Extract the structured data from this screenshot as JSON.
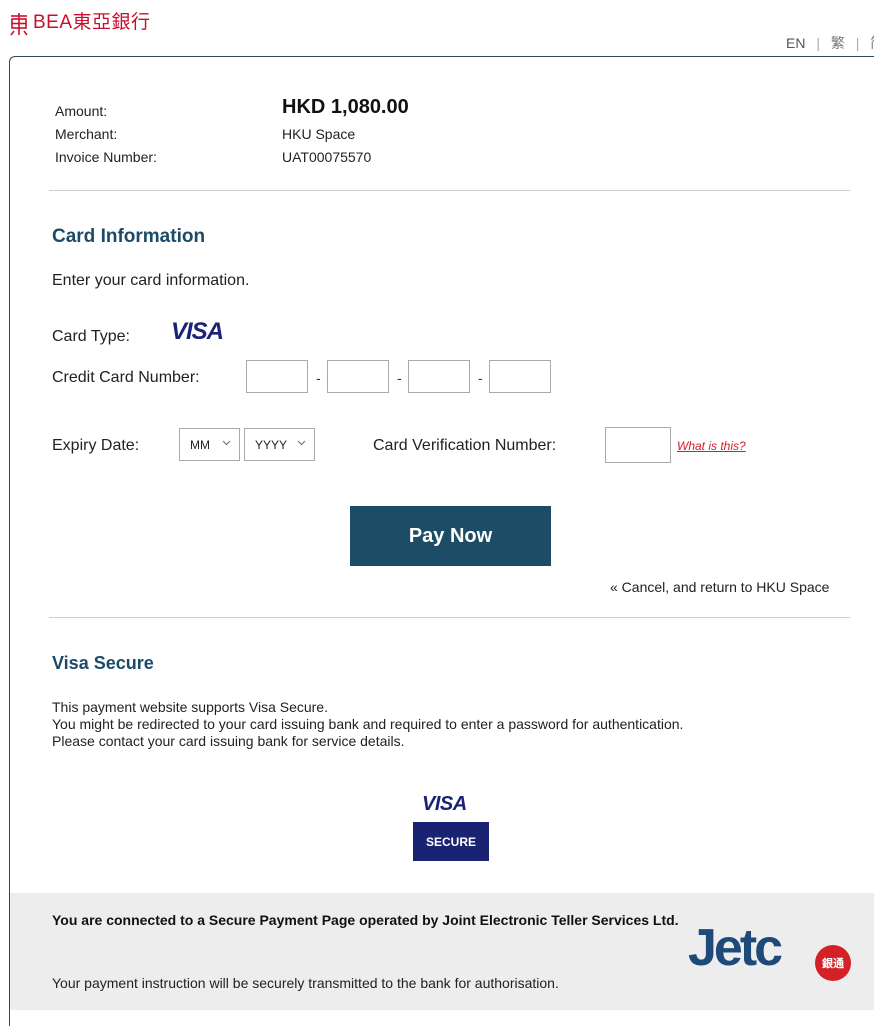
{
  "header": {
    "logo_text": "BEA東亞銀行",
    "languages": [
      "EN",
      "繁",
      "简"
    ]
  },
  "summary": {
    "amount_label": "Amount:",
    "amount_value": "HKD 1,080.00",
    "merchant_label": "Merchant:",
    "merchant_value": "HKU Space",
    "invoice_label": "Invoice Number:",
    "invoice_value": "UAT00075570"
  },
  "card_info": {
    "title": "Card Information",
    "intro": "Enter your card information.",
    "card_type_label": "Card Type:",
    "card_type_value": "VISA",
    "card_number_label": "Credit Card Number:",
    "card_number_separator": "-",
    "expiry_label": "Expiry Date:",
    "expiry_month_selected": "MM",
    "expiry_year_selected": "YYYY",
    "cvv_label": "Card Verification Number:",
    "what_is_this": "What is this?",
    "pay_button": "Pay Now",
    "cancel_link": "« Cancel, and return to HKU Space"
  },
  "visa_secure": {
    "title": "Visa Secure",
    "lines": [
      "This payment website supports Visa Secure.",
      "You might be redirected to your card issuing bank and required to enter a password for authentication.",
      "Please contact your card issuing bank for service details."
    ],
    "logo_visa": "VISA",
    "logo_secure": "SECURE"
  },
  "footer": {
    "title": "You are connected to a Secure Payment Page operated by Joint Electronic Teller Services Ltd.",
    "note": "Your payment instruction will be securely transmitted to the bank for authorisation.",
    "jetco_text": "Jetc",
    "jetco_badge": "銀通"
  },
  "colors": {
    "brand_red": "#c8102e",
    "section_title": "#1c4a67",
    "pay_button_bg": "#1d4d66",
    "visa_blue": "#1a2373",
    "link_red": "#d4202a",
    "footer_bg": "#ededed"
  },
  "icons": {
    "logo_mark": "bea-logo-icon",
    "chevron": "chevron-down-icon"
  }
}
